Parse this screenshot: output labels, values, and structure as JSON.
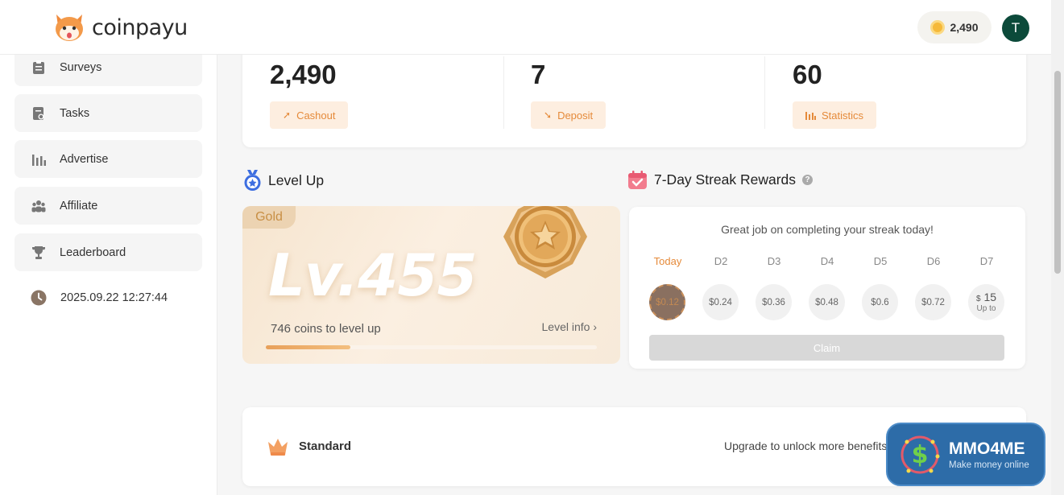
{
  "header": {
    "logo_text": "coinpayu",
    "balance": "2,490",
    "avatar_initial": "T"
  },
  "sidebar": {
    "items": [
      {
        "label": "Surveys",
        "icon": "clipboard-icon"
      },
      {
        "label": "Tasks",
        "icon": "task-icon"
      },
      {
        "label": "Advertise",
        "icon": "bar-chart-icon"
      },
      {
        "label": "Affiliate",
        "icon": "people-icon"
      },
      {
        "label": "Leaderboard",
        "icon": "trophy-icon"
      }
    ],
    "datetime": "2025.09.22 12:27:44"
  },
  "stats": [
    {
      "value": "2,490",
      "button": "Cashout",
      "icon": "cashout-arrow-icon"
    },
    {
      "value": "7",
      "button": "Deposit",
      "icon": "deposit-arrow-icon"
    },
    {
      "value": "60",
      "button": "Statistics",
      "icon": "statistics-bars-icon"
    }
  ],
  "level": {
    "title": "Level Up",
    "tier": "Gold",
    "level_text": "Lv.455",
    "note": "746 coins to level up",
    "info_link": "Level info ›",
    "progress_fraction": 0.255
  },
  "streak": {
    "title": "7-Day Streak Rewards",
    "message": "Great job on completing your streak today!",
    "days": [
      {
        "label": "Today",
        "reward": "$0.12"
      },
      {
        "label": "D2",
        "reward": "$0.24"
      },
      {
        "label": "D3",
        "reward": "$0.36"
      },
      {
        "label": "D4",
        "reward": "$0.48"
      },
      {
        "label": "D5",
        "reward": "$0.6"
      },
      {
        "label": "D6",
        "reward": "$0.72"
      },
      {
        "label": "D7",
        "reward_currency": "$",
        "reward_amount": "15",
        "reward_note": "Up to"
      }
    ],
    "claim_label": "Claim"
  },
  "plan": {
    "name": "Standard",
    "upgrade_text": "Upgrade to unlock more benefits"
  },
  "watermark": {
    "title": "MMO4ME",
    "subtitle": "Make money online"
  },
  "colors": {
    "accent": "#e58a3a",
    "avatar": "#0c4a3a",
    "watermark": "#2d6ca8"
  }
}
